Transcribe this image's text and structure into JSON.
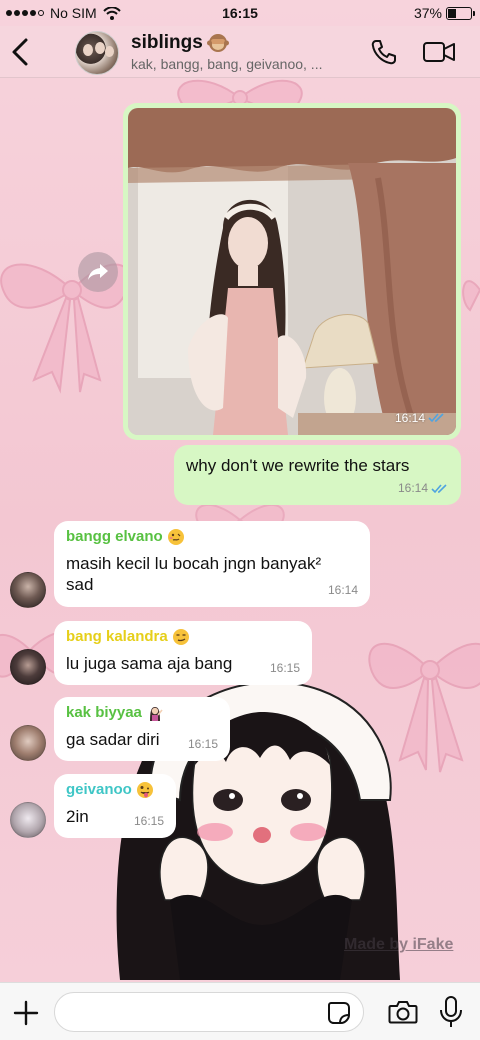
{
  "status_bar": {
    "carrier": "No SIM",
    "time": "16:15",
    "battery_percent": "37%",
    "battery_level": 0.37
  },
  "header": {
    "group_name": "siblings",
    "group_emoji": "see-no-evil-monkey",
    "members": "kak, bangg, bang, geivanoo, ..."
  },
  "messages": {
    "image_message": {
      "time": "16:14",
      "status": "read"
    },
    "outgoing_text": {
      "text": "why don't we rewrite the stars",
      "time": "16:14",
      "status": "read"
    },
    "m1": {
      "sender": "bangg elvano",
      "sender_color": "#58c142",
      "emoji": "woozy-face",
      "text_line1": "masih kecil lu bocah jngn banyak²",
      "text_line2": "sad",
      "time": "16:14"
    },
    "m2": {
      "sender": "bang kalandra",
      "sender_color": "#e6cf1a",
      "emoji": "smirking-face",
      "text": "lu juga sama aja bang",
      "time": "16:15"
    },
    "m3": {
      "sender": "kak biyyaa",
      "sender_color": "#58c142",
      "emoji": "woman-gesturing-icon",
      "text": "ga sadar diri",
      "time": "16:15"
    },
    "m4": {
      "sender": "geivanoo",
      "sender_color": "#3fc6c6",
      "emoji": "zany-face",
      "text": "2in",
      "time": "16:15"
    }
  },
  "watermark": "Made by iFake",
  "input": {
    "placeholder": "",
    "value": ""
  },
  "colors": {
    "outgoing_bubble": "#d7f7c4",
    "incoming_bubble": "#ffffff",
    "read_ticks": "#4fa3e0",
    "wallpaper": "#f6cfd9"
  }
}
